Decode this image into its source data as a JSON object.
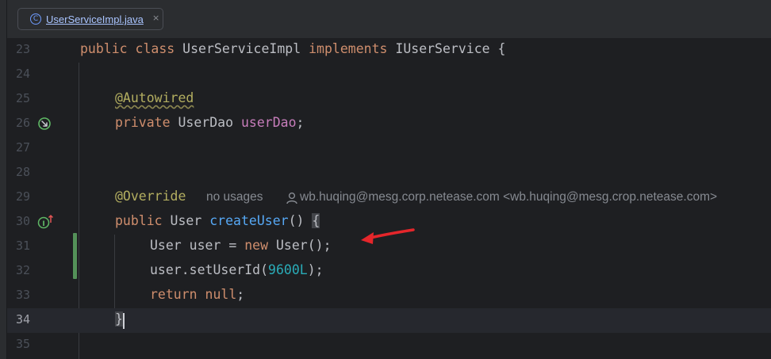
{
  "tab": {
    "icon_letter": "C",
    "filename": "UserServiceImpl.java",
    "close_glyph": "×"
  },
  "editor": {
    "lines": [
      {
        "num": "23"
      },
      {
        "num": "24"
      },
      {
        "num": "25"
      },
      {
        "num": "26"
      },
      {
        "num": "27"
      },
      {
        "num": "28"
      },
      {
        "num": "29"
      },
      {
        "num": "30"
      },
      {
        "num": "31"
      },
      {
        "num": "32"
      },
      {
        "num": "33"
      },
      {
        "num": "34"
      },
      {
        "num": "35"
      }
    ],
    "code": {
      "l23": {
        "public": "public",
        "class": "class",
        "name": "UserServiceImpl",
        "implements": "implements",
        "iface": "IUserService",
        "brace": "{"
      },
      "l25": {
        "annotation": "@Autowired"
      },
      "l26": {
        "private": "private",
        "type": "UserDao",
        "field": "userDao",
        "semi": ";"
      },
      "l29": {
        "annotation": "@Override",
        "usages": "no usages",
        "author": "wb.huqing@mesg.corp.netease.com <wb.huqing@mesg.crop.netease.com>"
      },
      "l30": {
        "public": "public",
        "type": "User",
        "method": "createUser",
        "parens": "()",
        "brace": "{"
      },
      "l31": {
        "decl": "User user = ",
        "new": "new",
        "ctor": "User();"
      },
      "l32": {
        "call": "user.setUserId(",
        "number": "9600L",
        "end": ");"
      },
      "l33": {
        "return": "return",
        "null": "null",
        "semi": ";"
      },
      "l34": {
        "brace": "}"
      }
    }
  },
  "colors": {
    "background": "#1e1f22",
    "keyword": "#cf8e6d",
    "annotation": "#b3ae60",
    "field": "#c77dbb",
    "method": "#56a8f5",
    "number": "#2aacb8",
    "change_marker": "#549159",
    "arrow": "#e5262b"
  },
  "icons": {
    "line26_gutter": "bean-navigate-icon",
    "line30_gutter": "implements-method-icon",
    "author_hint": "person-icon",
    "annotation_arrow": "red-arrow-icon"
  }
}
